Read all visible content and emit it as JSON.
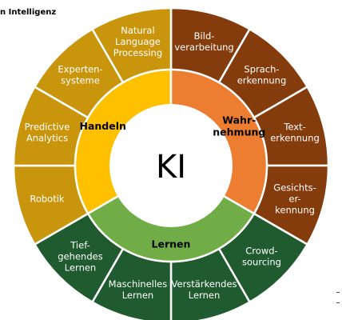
{
  "title": "n Intelligenz",
  "center": {
    "label": "KI"
  },
  "colors": {
    "handeln_outer": "#C9950C",
    "handeln_inner": "#FFC000",
    "wahrnehmung_outer": "#843C0C",
    "wahrnehmung_inner": "#ED7D31",
    "lernen_outer": "#1F5B2E",
    "lernen_inner": "#70AD47",
    "center": "#FFFFFF"
  },
  "inner_segments": [
    {
      "id": "handeln",
      "label": "Handeln"
    },
    {
      "id": "wahrnehmung",
      "lines": [
        "Wahr-",
        "nehmung"
      ]
    },
    {
      "id": "lernen",
      "label": "Lernen"
    }
  ],
  "outer_segments": [
    {
      "id": "bildverarbeitung",
      "group": "wahrnehmung",
      "lines": [
        "Bild-",
        "verarbeitung"
      ]
    },
    {
      "id": "spracherkennung",
      "group": "wahrnehmung",
      "lines": [
        "Sprach-",
        "erkennung"
      ]
    },
    {
      "id": "texterkennung",
      "group": "wahrnehmung",
      "lines": [
        "Text-",
        "erkennung"
      ]
    },
    {
      "id": "gesichtserkennung",
      "group": "wahrnehmung",
      "lines": [
        "Gesichts-",
        "er-",
        "kennung"
      ]
    },
    {
      "id": "crowdsourcing",
      "group": "lernen",
      "lines": [
        "Crowd-",
        "sourcing"
      ]
    },
    {
      "id": "verstaerkendes-lernen",
      "group": "lernen",
      "lines": [
        "Verstärkendes",
        "Lernen"
      ]
    },
    {
      "id": "maschinelles-lernen",
      "group": "lernen",
      "lines": [
        "Maschinelles",
        "Lernen"
      ]
    },
    {
      "id": "tiefgehendes-lernen",
      "group": "lernen",
      "lines": [
        "Tief-",
        "gehendes",
        "Lernen"
      ]
    },
    {
      "id": "robotik",
      "group": "handeln",
      "lines": [
        "Robotik"
      ]
    },
    {
      "id": "predictive-analytics",
      "group": "handeln",
      "lines": [
        "Predictive",
        "Analytics"
      ]
    },
    {
      "id": "expertensysteme",
      "group": "handeln",
      "lines": [
        "Experten-",
        "systeme"
      ]
    },
    {
      "id": "natural-language-processing",
      "group": "handeln",
      "lines": [
        "Natural",
        "Language",
        "Processing"
      ]
    }
  ]
}
